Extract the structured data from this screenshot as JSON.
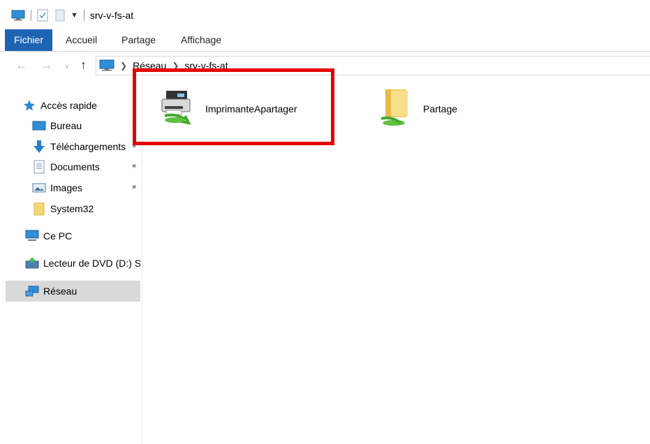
{
  "window": {
    "title": "srv-v-fs-at"
  },
  "ribbon": {
    "tabs": [
      {
        "label": "Fichier"
      },
      {
        "label": "Accueil"
      },
      {
        "label": "Partage"
      },
      {
        "label": "Affichage"
      }
    ]
  },
  "address": {
    "crumbs": [
      "Réseau",
      "srv-v-fs-at"
    ]
  },
  "sidebar": {
    "quick_access": "Accès rapide",
    "items": [
      {
        "label": "Bureau",
        "pinned": true
      },
      {
        "label": "Téléchargements",
        "pinned": true
      },
      {
        "label": "Documents",
        "pinned": true
      },
      {
        "label": "Images",
        "pinned": true
      },
      {
        "label": "System32",
        "pinned": false
      }
    ],
    "this_pc": "Ce PC",
    "dvd": "Lecteur de DVD (D:) S",
    "network": "Réseau"
  },
  "content": {
    "items": [
      {
        "name": "ImprimanteApartager",
        "type": "printer"
      },
      {
        "name": "Partage",
        "type": "shared-folder"
      }
    ]
  },
  "colors": {
    "accent": "#1e64b4",
    "highlight": "#e60000",
    "selection": "#d9d9d9"
  }
}
